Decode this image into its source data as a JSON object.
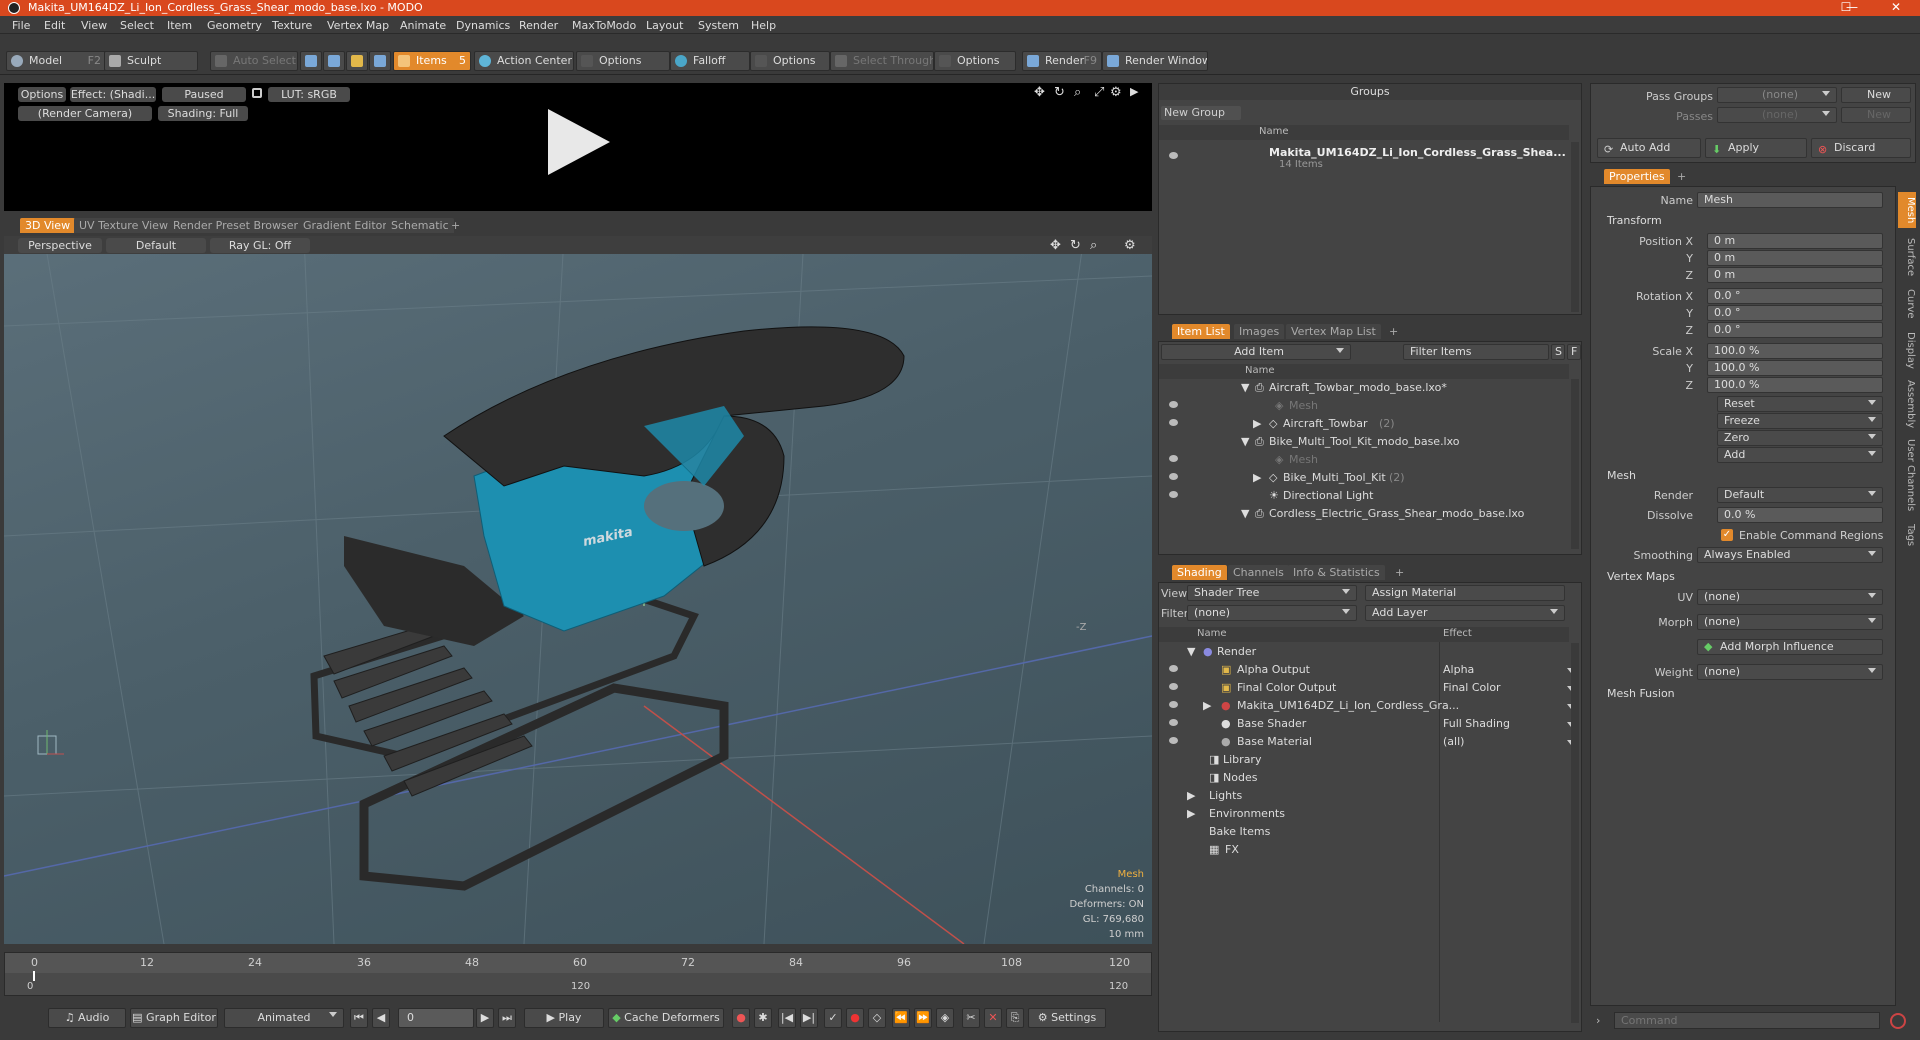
{
  "window": {
    "title": "Makita_UM164DZ_Li_Ion_Cordless_Grass_Shear_modo_base.lxo - MODO",
    "minimize": "—",
    "maximize": "☐",
    "close": "✕"
  },
  "menu": [
    "File",
    "Edit",
    "View",
    "Select",
    "Item",
    "Geometry",
    "Texture",
    "Vertex Map",
    "Animate",
    "Dynamics",
    "Render",
    "MaxToModo",
    "Layout",
    "System",
    "Help"
  ],
  "toolbar": {
    "model": "Model",
    "model_key": "F2",
    "sculpt": "Sculpt",
    "auto_select": "Auto Select",
    "items": "Items",
    "items_key": "5",
    "action_center": "Action Center",
    "options1": "Options",
    "falloff": "Falloff",
    "options2": "Options",
    "select_through": "Select Through",
    "options3": "Options",
    "render": "Render",
    "render_key": "F9",
    "render_window": "Render Window"
  },
  "preview": {
    "options": "Options",
    "effect": "Effect: (Shadi...",
    "paused": "Paused",
    "lut": "LUT: sRGB",
    "camera": "(Render Camera)",
    "shading": "Shading: Full"
  },
  "viewport_tabs": [
    "3D View",
    "UV Texture View",
    "Render Preset Browser",
    "Gradient Editor",
    "Schematic",
    "+"
  ],
  "viewport": {
    "perspective": "Perspective",
    "default": "Default",
    "raygl": "Ray GL: Off",
    "brand": "makita",
    "axis_label": "-Z",
    "info": [
      "Mesh",
      "Channels: 0",
      "Deformers: ON",
      "GL: 769,680",
      "10 mm"
    ]
  },
  "timeline": {
    "ticks": [
      "0",
      "12",
      "24",
      "36",
      "48",
      "60",
      "72",
      "84",
      "96",
      "108",
      "120"
    ],
    "bottom_ticks": [
      "0",
      "120",
      "120"
    ]
  },
  "bottombar": {
    "audio": "Audio",
    "graph_editor": "Graph Editor",
    "animated": "Animated",
    "frame": "0",
    "play": "Play",
    "cache": "Cache Deformers",
    "settings": "Settings"
  },
  "groups": {
    "title": "Groups",
    "new_group": "New Group",
    "col_name": "Name",
    "item_name": "Makita_UM164DZ_Li_Ion_Cordless_Grass_Shea...",
    "item_count": "14 Items"
  },
  "itemlist": {
    "tabs": [
      "Item List",
      "Images",
      "Vertex Map List",
      "+"
    ],
    "add_item": "Add Item",
    "filter": "Filter Items",
    "filter_s": "S",
    "filter_f": "F",
    "col_name": "Name",
    "rows": [
      {
        "name": "Aircraft_Towbar_modo_base.lxo*",
        "indent": 0,
        "dim": false
      },
      {
        "name": "Mesh",
        "indent": 2,
        "dim": true
      },
      {
        "name": "Aircraft_Towbar",
        "indent": 1,
        "dim": false,
        "count": "(2)"
      },
      {
        "name": "Bike_Multi_Tool_Kit_modo_base.lxo",
        "indent": 0,
        "dim": false
      },
      {
        "name": "Mesh",
        "indent": 2,
        "dim": true
      },
      {
        "name": "Bike_Multi_Tool_Kit",
        "indent": 1,
        "dim": false,
        "count": "(2)"
      },
      {
        "name": "Directional Light",
        "indent": 1,
        "dim": false
      },
      {
        "name": "Cordless_Electric_Grass_Shear_modo_base.lxo",
        "indent": 0,
        "dim": false
      }
    ]
  },
  "shading": {
    "tabs": [
      "Shading",
      "Channels",
      "Info & Statistics",
      "+"
    ],
    "view_label": "View",
    "view_value": "Shader Tree",
    "assign": "Assign Material",
    "filter_label": "Filter",
    "filter_value": "(none)",
    "add_layer": "Add Layer",
    "col_name": "Name",
    "col_effect": "Effect",
    "rows": [
      {
        "name": "Render",
        "effect": ""
      },
      {
        "name": "Alpha Output",
        "effect": "Alpha"
      },
      {
        "name": "Final Color Output",
        "effect": "Final Color"
      },
      {
        "name": "Makita_UM164DZ_Li_Ion_Cordless_Gra...",
        "effect": ""
      },
      {
        "name": "Base Shader",
        "effect": "Full Shading"
      },
      {
        "name": "Base Material",
        "effect": "(all)"
      },
      {
        "name": "Library",
        "effect": ""
      },
      {
        "name": "Nodes",
        "effect": ""
      },
      {
        "name": "Lights",
        "effect": ""
      },
      {
        "name": "Environments",
        "effect": ""
      },
      {
        "name": "Bake Items",
        "effect": ""
      },
      {
        "name": "FX",
        "effect": ""
      }
    ]
  },
  "passes": {
    "pass_groups": "Pass Groups",
    "passes": "Passes",
    "none": "(none)",
    "new": "New",
    "auto_add": "Auto Add",
    "apply": "Apply",
    "discard": "Discard"
  },
  "properties": {
    "tab": "Properties",
    "name_label": "Name",
    "name_value": "Mesh",
    "transform": "Transform",
    "position_label": "Position X",
    "rotation_label": "Rotation X",
    "scale_label": "Scale X",
    "y": "Y",
    "z": "Z",
    "position": [
      "0 m",
      "0 m",
      "0 m"
    ],
    "rotation": [
      "0.0 °",
      "0.0 °",
      "0.0 °"
    ],
    "scale": [
      "100.0 %",
      "100.0 %",
      "100.0 %"
    ],
    "reset": "Reset",
    "freeze": "Freeze",
    "zero": "Zero",
    "add": "Add",
    "mesh": "Mesh",
    "render_label": "Render",
    "render_value": "Default",
    "dissolve_label": "Dissolve",
    "dissolve_value": "0.0 %",
    "enable_cmd": "Enable Command Regions",
    "smoothing_label": "Smoothing",
    "smoothing_value": "Always Enabled",
    "vertex_maps": "Vertex Maps",
    "uv_label": "UV",
    "uv_value": "(none)",
    "morph_label": "Morph",
    "morph_value": "(none)",
    "add_morph": "Add Morph Influence",
    "weight_label": "Weight",
    "weight_value": "(none)",
    "mesh_fusion": "Mesh Fusion",
    "side_tabs": [
      "Mesh",
      "Surface",
      "Curve",
      "Display",
      "Assembly",
      "User Channels",
      "Tags"
    ]
  },
  "command": {
    "placeholder": "Command"
  },
  "colors": {
    "accent": "#e2892b",
    "title": "#d9481e",
    "tool_body": "#1d8fb0"
  }
}
